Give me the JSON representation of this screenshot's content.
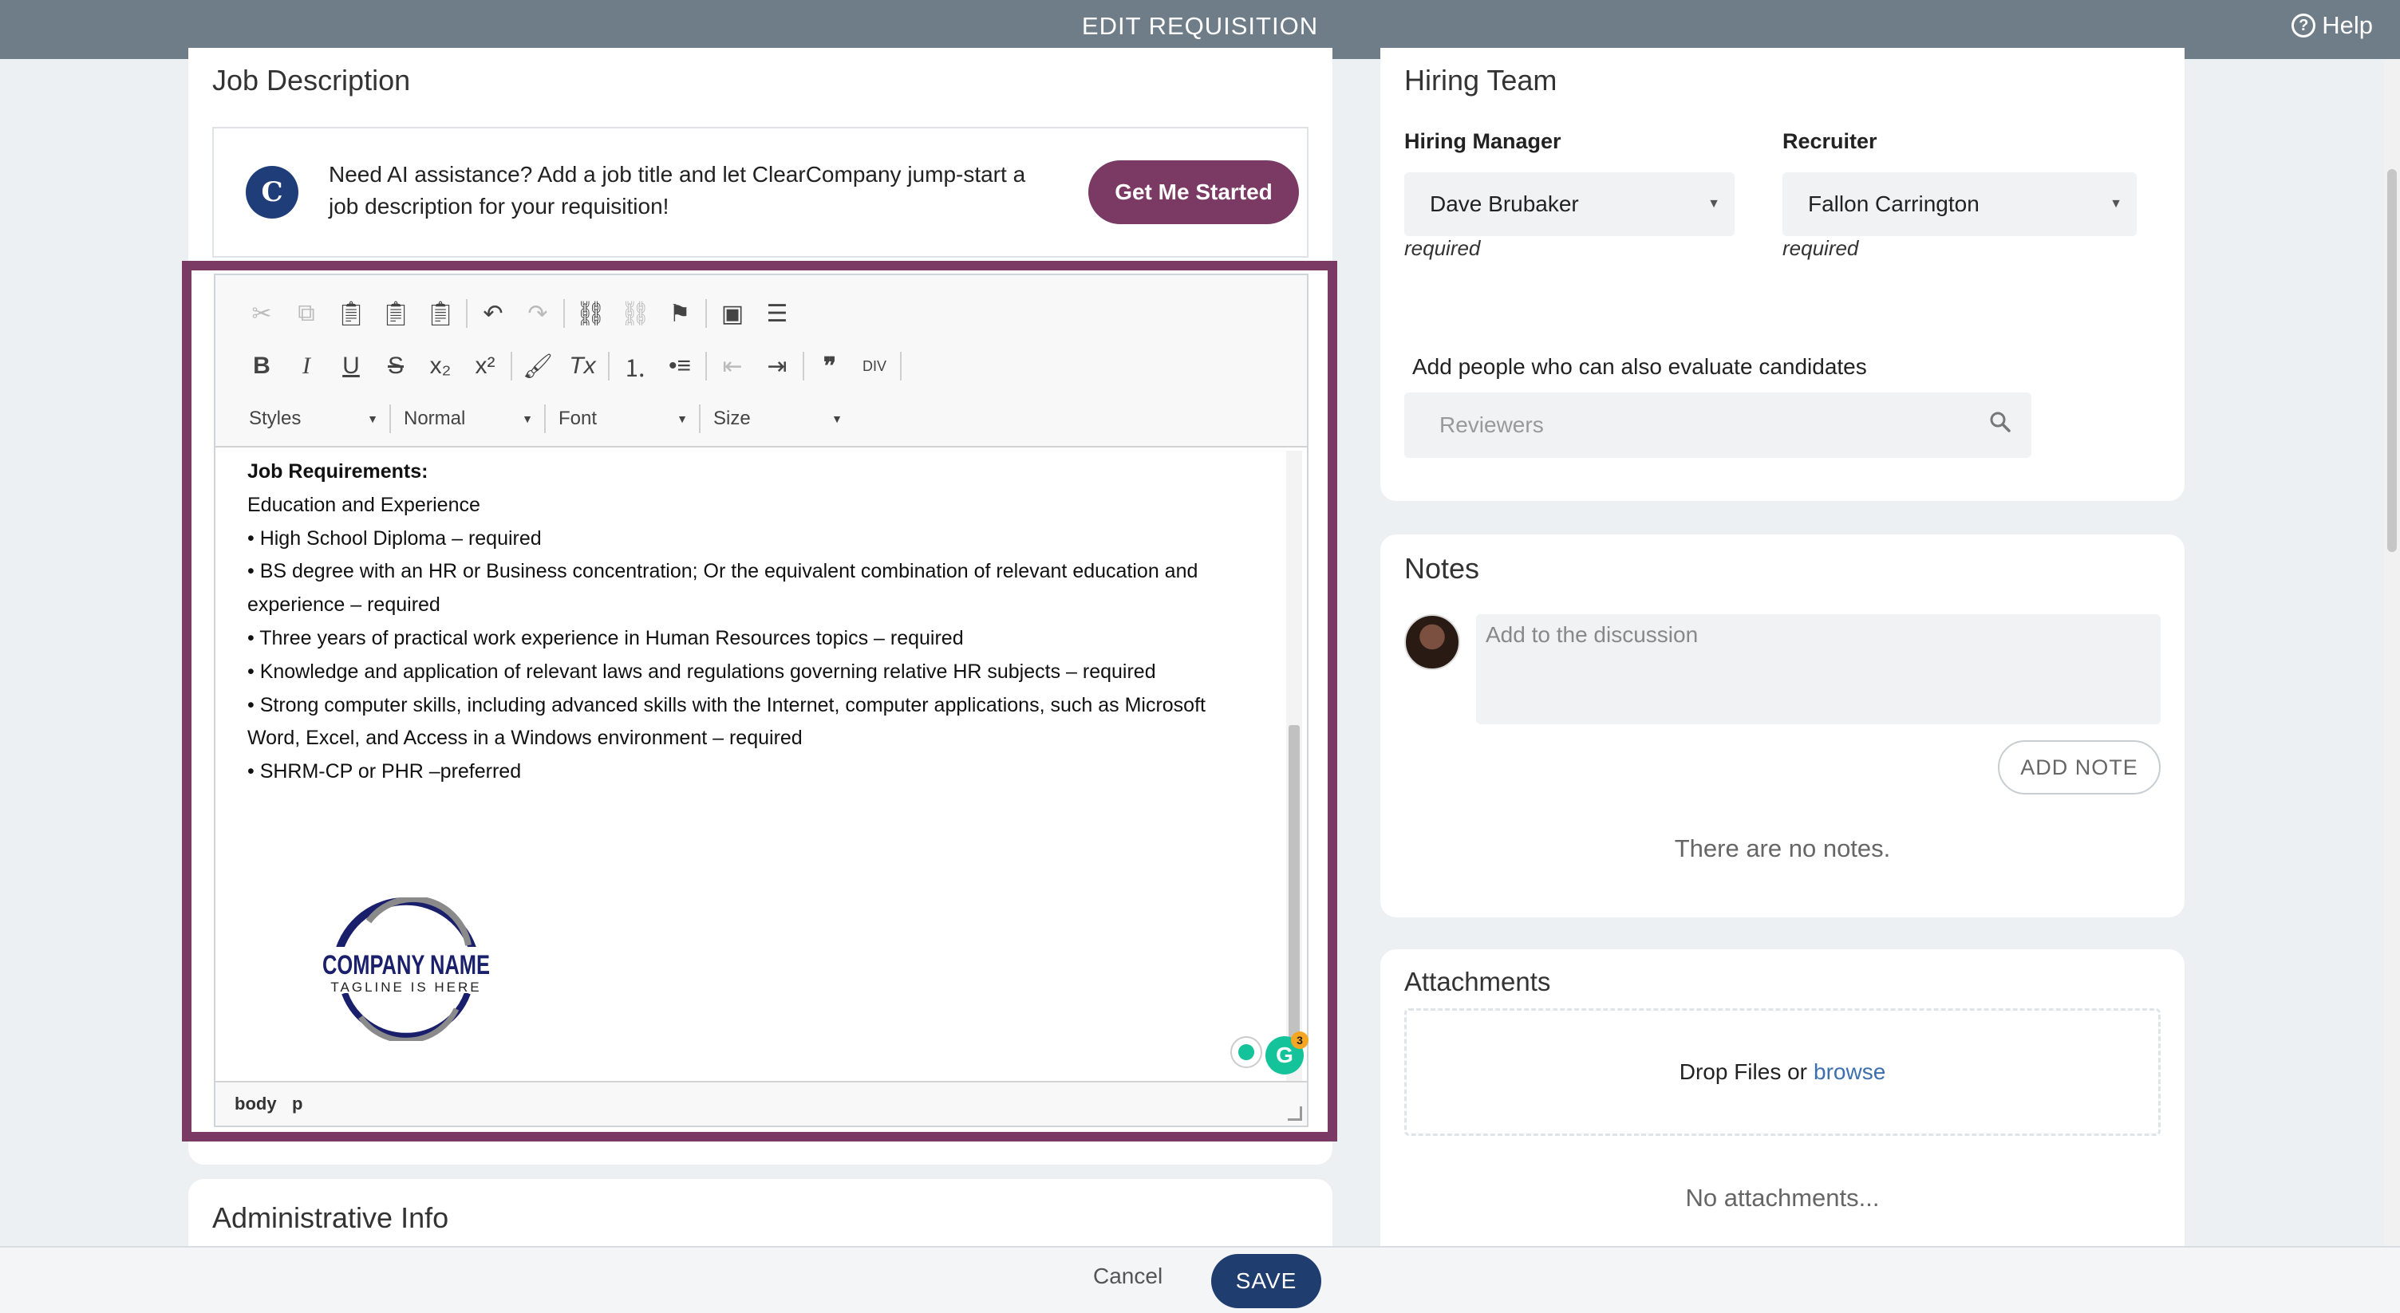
{
  "header": {
    "title": "EDIT REQUISITION",
    "help_label": "Help"
  },
  "job_description": {
    "title": "Job Description",
    "ai_prompt": "Need AI assistance? Add a job title and let ClearCompany jump-start a job description for your requisition!",
    "ai_button": "Get Me Started",
    "toolbar": {
      "styles": "Styles",
      "format": "Normal",
      "font": "Font",
      "size": "Size"
    },
    "content": {
      "heading": "Job Requirements:",
      "subheading": "Education and Experience",
      "lines": [
        "• High School Diploma – required",
        "• BS degree with an HR or Business concentration; Or the equivalent combination of relevant education and experience – required",
        "• Three years of practical work experience in Human Resources topics – required",
        "• Knowledge and application of relevant laws and regulations governing relative HR subjects – required",
        "• Strong computer skills, including advanced skills with the Internet, computer applications, such as Microsoft Word, Excel, and Access in a Windows environment – required",
        "• SHRM-CP or PHR –preferred"
      ],
      "logo_name": "COMPANY NAME",
      "logo_tagline": "TAGLINE IS HERE"
    },
    "statusbar": {
      "path_1": "body",
      "path_2": "p"
    },
    "grammarly_count": "3"
  },
  "admin": {
    "title": "Administrative Info"
  },
  "hiring_team": {
    "title": "Hiring Team",
    "manager_label": "Hiring Manager",
    "manager_value": "Dave Brubaker",
    "recruiter_label": "Recruiter",
    "recruiter_value": "Fallon Carrington",
    "required_text": "required",
    "reviewers_label": "Add people who can also evaluate candidates",
    "reviewers_placeholder": "Reviewers"
  },
  "notes": {
    "title": "Notes",
    "placeholder": "Add to the discussion",
    "add_button": "ADD NOTE",
    "empty": "There are no notes."
  },
  "attachments": {
    "title": "Attachments",
    "drop_text": "Drop Files or",
    "browse": "browse",
    "empty": "No attachments..."
  },
  "footer": {
    "cancel": "Cancel",
    "save": "SAVE"
  },
  "colors": {
    "accent": "#7b3a64",
    "topbar": "#6f7d89",
    "save": "#1f3d6e",
    "link": "#3c6fb0"
  }
}
